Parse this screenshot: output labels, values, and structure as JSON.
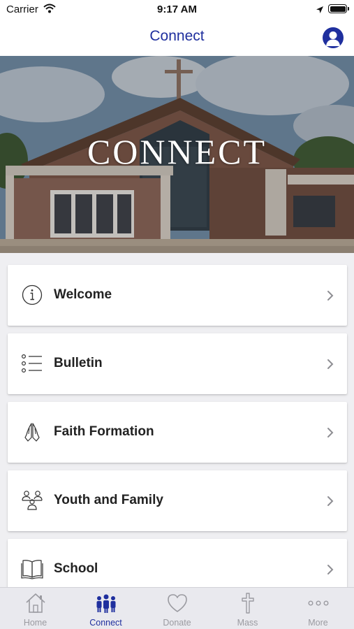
{
  "status_bar": {
    "carrier": "Carrier",
    "time": "9:17 AM"
  },
  "nav": {
    "title": "Connect",
    "profile_icon": "person-circle-icon"
  },
  "hero": {
    "text": "CONNECT",
    "image": "church-building-photo"
  },
  "menu": [
    {
      "label": "Welcome",
      "icon": "info-circle-icon"
    },
    {
      "label": "Bulletin",
      "icon": "bullet-list-icon"
    },
    {
      "label": "Faith Formation",
      "icon": "praying-hands-icon"
    },
    {
      "label": "Youth and Family",
      "icon": "family-group-icon"
    },
    {
      "label": "School",
      "icon": "open-book-icon"
    }
  ],
  "tabs": [
    {
      "label": "Home",
      "icon": "home-icon",
      "active": false
    },
    {
      "label": "Connect",
      "icon": "people-icon",
      "active": true
    },
    {
      "label": "Donate",
      "icon": "heart-icon",
      "active": false
    },
    {
      "label": "Mass",
      "icon": "cross-icon",
      "active": false
    },
    {
      "label": "More",
      "icon": "more-dots-icon",
      "active": false
    }
  ],
  "colors": {
    "accent": "#1f2f9e",
    "tab_inactive": "#9a9aa0",
    "background": "#efeff2"
  }
}
